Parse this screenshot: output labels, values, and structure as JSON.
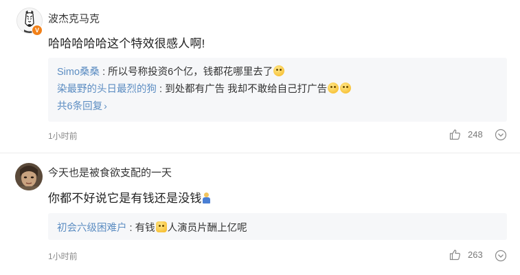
{
  "comments": [
    {
      "username": "波杰克马克",
      "verified_badge": "V",
      "text": "哈哈哈哈哈这个特效很感人啊!",
      "replies": [
        {
          "name": "Simo桑桑",
          "sep": ":",
          "text": "所以号称投资6个亿，钱都花哪里去了",
          "emojis": [
            "laugh-cry-emoji"
          ]
        },
        {
          "name": "染最野的头日最烈的狗",
          "sep": ":",
          "text": "到处都有广告 我却不敢给自己打广告",
          "emojis": [
            "smile-emoji",
            "smile-emoji"
          ]
        }
      ],
      "more_replies_label": "共6条回复",
      "time": "1小时前",
      "like_count": "248"
    },
    {
      "username": "今天也是被食欲支配的一天",
      "text": "你都不好说它是有钱还是没钱",
      "text_emoji": "person-shrug-emoji",
      "replies": [
        {
          "name": "初会六级困难户",
          "sep": ":",
          "text_before": "有钱",
          "text_after": "人演员片酬上亿呢",
          "emojis": [
            "doge-emoji"
          ]
        }
      ],
      "time": "1小时前",
      "like_count": "263"
    }
  ],
  "colors": {
    "link": "#5c8dc2",
    "badge": "#f28018",
    "reply_bg": "#f6f7f9"
  }
}
